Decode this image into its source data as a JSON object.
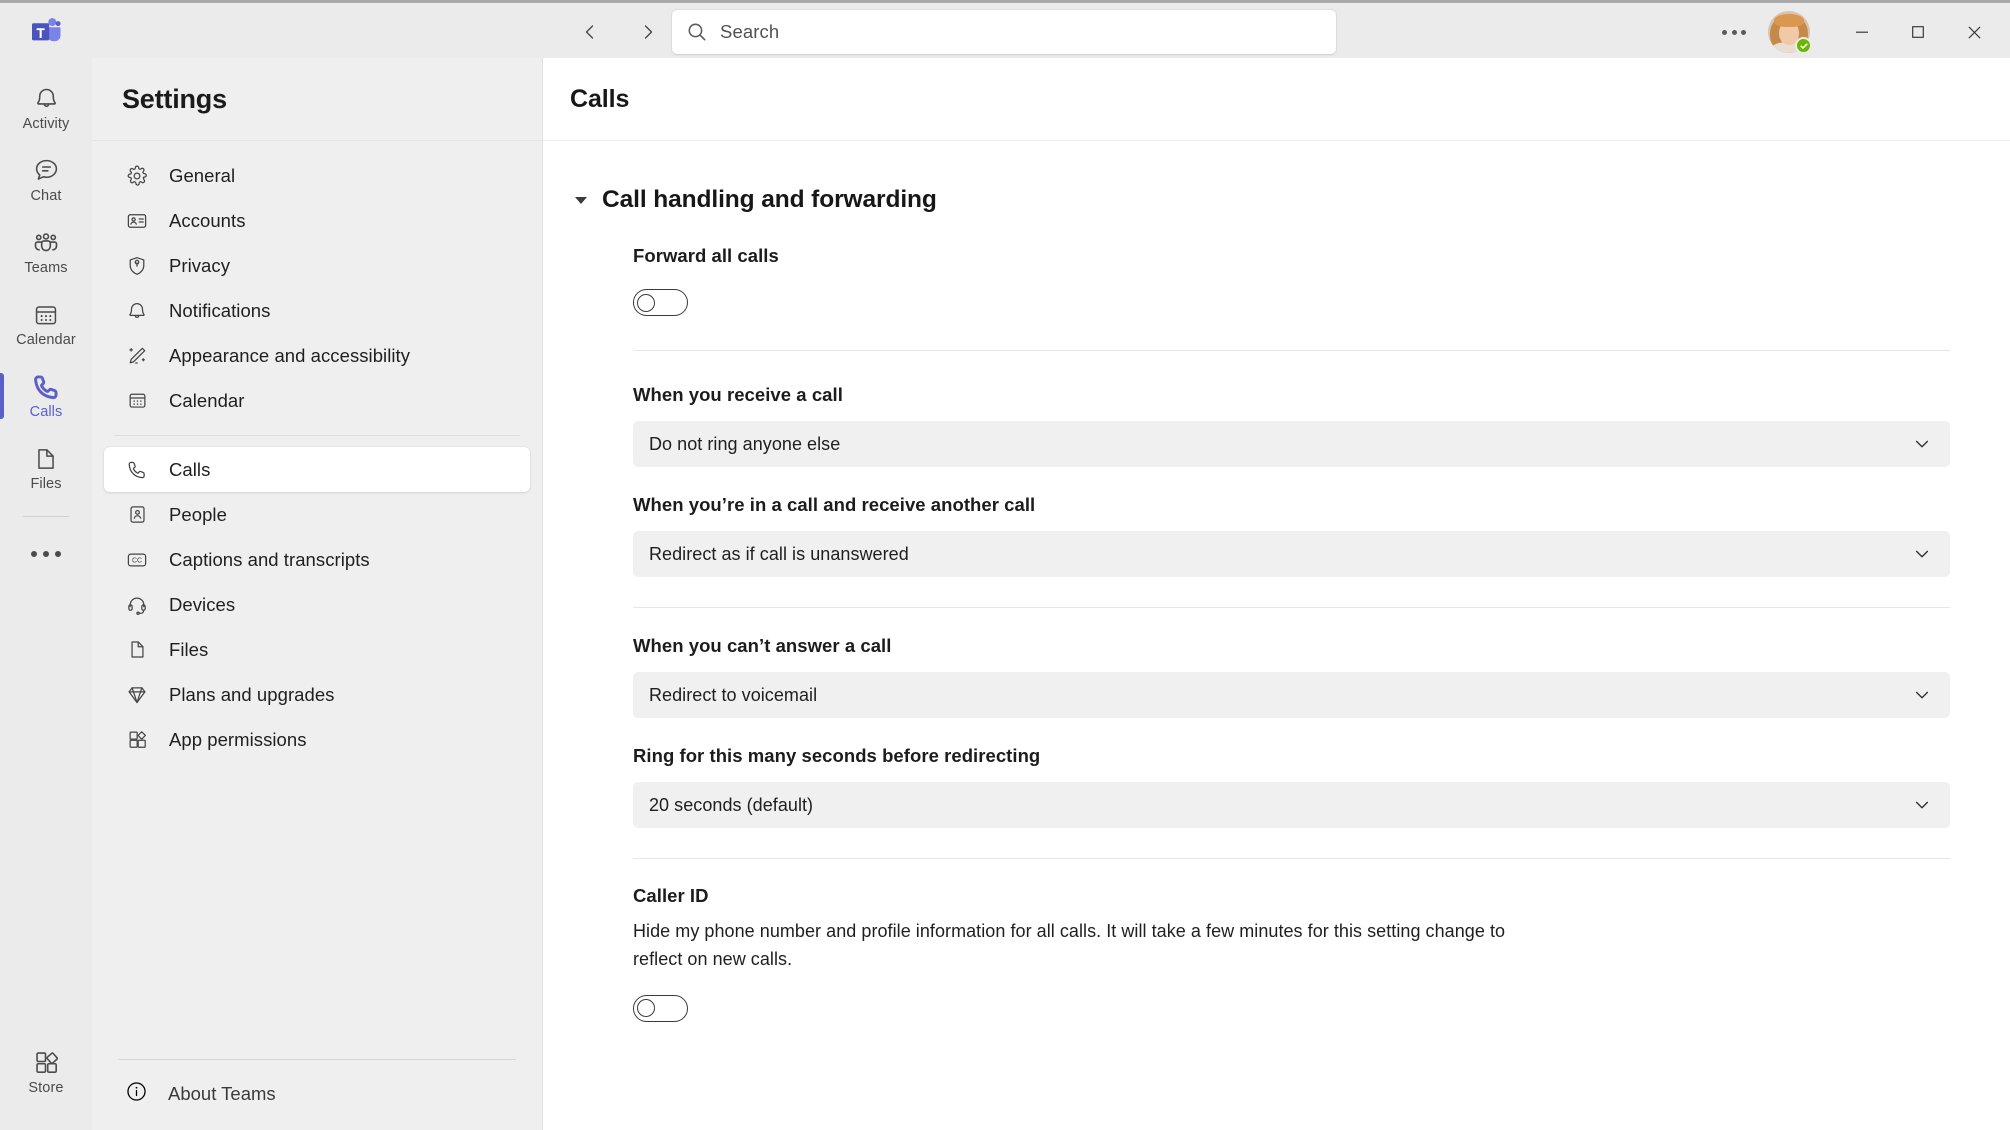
{
  "titlebar": {
    "logo_name": "microsoft-teams-logo",
    "back_label": "Back",
    "forward_label": "Forward",
    "search_placeholder": "Search",
    "search_value": "",
    "more_label": "Settings and more",
    "presence_status": "Available",
    "minimize_label": "Minimize",
    "maximize_label": "Maximize",
    "close_label": "Close"
  },
  "rail": {
    "items": [
      {
        "label": "Activity",
        "icon": "bell-icon",
        "active": false
      },
      {
        "label": "Chat",
        "icon": "chat-icon",
        "active": false
      },
      {
        "label": "Teams",
        "icon": "teams-icon",
        "active": false
      },
      {
        "label": "Calendar",
        "icon": "calendar-icon",
        "active": false
      },
      {
        "label": "Calls",
        "icon": "phone-icon",
        "active": true
      },
      {
        "label": "Files",
        "icon": "file-icon",
        "active": false
      }
    ],
    "more_label": "More apps",
    "store": {
      "label": "Store",
      "icon": "store-icon"
    }
  },
  "settings": {
    "title": "Settings",
    "group_one": [
      {
        "label": "General",
        "icon": "gear-icon"
      },
      {
        "label": "Accounts",
        "icon": "account-card-icon"
      },
      {
        "label": "Privacy",
        "icon": "shield-lock-icon"
      },
      {
        "label": "Notifications",
        "icon": "bell-icon"
      },
      {
        "label": "Appearance and accessibility",
        "icon": "magic-wand-icon"
      },
      {
        "label": "Calendar",
        "icon": "calendar-icon"
      }
    ],
    "group_two": [
      {
        "label": "Calls",
        "icon": "phone-icon",
        "selected": true
      },
      {
        "label": "People",
        "icon": "person-card-icon",
        "selected": false
      },
      {
        "label": "Captions and transcripts",
        "icon": "closed-caption-icon",
        "selected": false
      },
      {
        "label": "Devices",
        "icon": "headset-icon",
        "selected": false
      },
      {
        "label": "Files",
        "icon": "file-icon",
        "selected": false
      },
      {
        "label": "Plans and upgrades",
        "icon": "diamond-icon",
        "selected": false
      },
      {
        "label": "App permissions",
        "icon": "apps-icon",
        "selected": false
      }
    ],
    "about": {
      "label": "About Teams",
      "icon": "info-circle-icon"
    }
  },
  "main": {
    "page_title": "Calls",
    "section": {
      "title": "Call handling and forwarding",
      "expanded": true
    },
    "forward_all_calls": {
      "label": "Forward all calls",
      "toggle_state": "off"
    },
    "dropdowns": [
      {
        "label": "When you receive a call",
        "value": "Do not ring anyone else",
        "name": "when-you-receive-a-call"
      },
      {
        "label": "When you’re in a call and receive another call",
        "value": "Redirect as if call is unanswered",
        "name": "when-in-call-receive-another"
      },
      {
        "label": "When you can’t answer a call",
        "value": "Redirect to voicemail",
        "name": "when-cant-answer-a-call"
      },
      {
        "label": "Ring for this many seconds before redirecting",
        "value": "20 seconds (default)",
        "name": "ring-seconds-before-redirecting"
      }
    ],
    "caller_id": {
      "label": "Caller ID",
      "description": "Hide my phone number and profile information for all calls. It will take a few minutes for this setting change to reflect on new calls.",
      "toggle_state": "off"
    }
  },
  "colors": {
    "accent": "#5b5fc7",
    "rail_bg": "#ebebeb",
    "panel_bg": "#efefef",
    "content_bg": "#ffffff",
    "presence_green": "#6bb700",
    "dropdown_bg": "#f0f0f0"
  }
}
